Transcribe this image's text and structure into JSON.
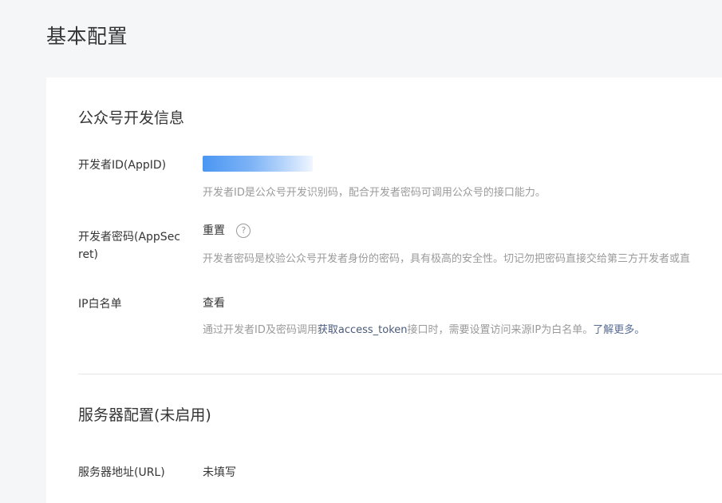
{
  "page": {
    "title": "基本配置"
  },
  "dev_info": {
    "section_title": "公众号开发信息",
    "appid": {
      "label": "开发者ID(AppID)",
      "tip": "开发者ID是公众号开发识别码，配合开发者密码可调用公众号的接口能力。"
    },
    "appsecret": {
      "label_line1": "开发者密码(AppSec",
      "label_line2": "ret)",
      "reset_label": "重置",
      "help_icon": "question-circle-icon",
      "tip": "开发者密码是校验公众号开发者身份的密码，具有极高的安全性。切记勿把密码直接交给第三方开发者或直"
    },
    "ip_whitelist": {
      "label": "IP白名单",
      "view_label": "查看",
      "tip_prefix": "通过开发者ID及密码调用",
      "tip_link": "获取access_token",
      "tip_middle": "接口时，需要设置访问来源IP为白名单。",
      "tip_more": "了解更多。"
    }
  },
  "server_config": {
    "section_title": "服务器配置(未启用)",
    "url": {
      "label": "服务器地址(URL)",
      "value": "未填写"
    }
  },
  "colors": {
    "link": "#576b95",
    "tip": "#9a9a9a",
    "text": "#353535",
    "background": "#f5f6f7"
  }
}
